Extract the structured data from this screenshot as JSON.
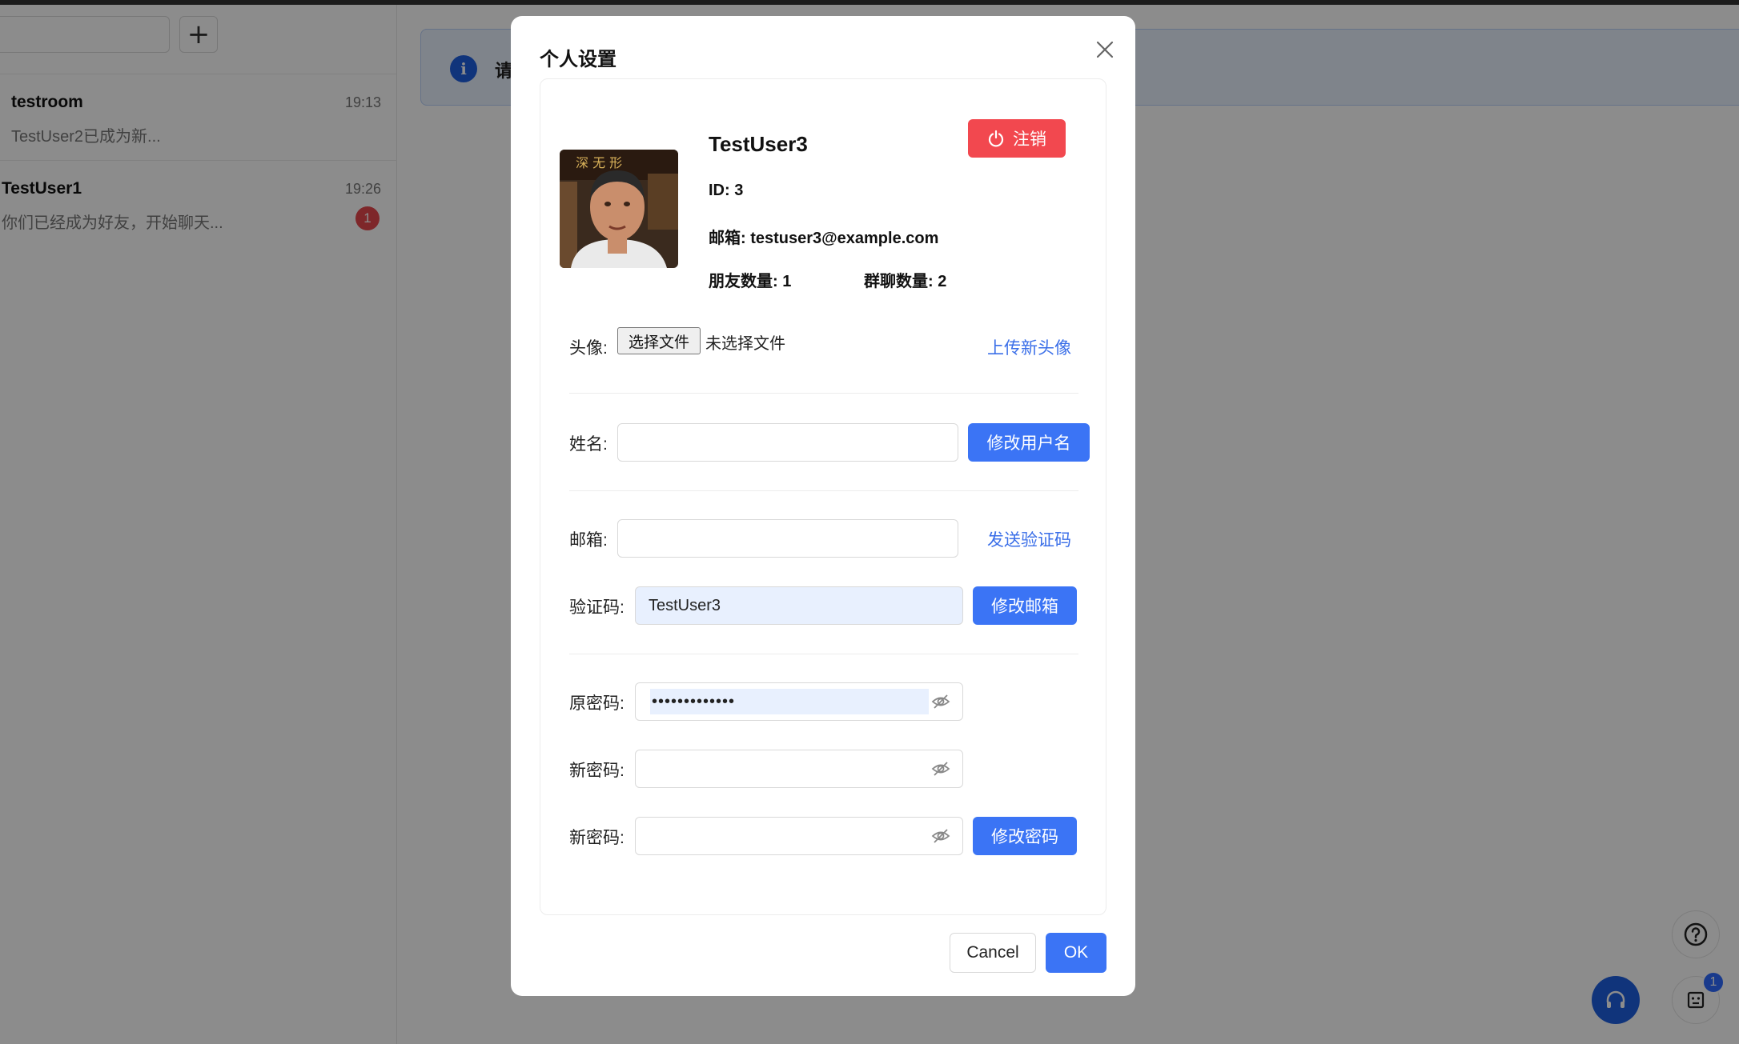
{
  "sidebar": {
    "add_icon": "plus-icon",
    "conversations": [
      {
        "name": "testroom",
        "time": "19:13",
        "preview": "TestUser2已成为新..."
      },
      {
        "name": "TestUser1",
        "time": "19:26",
        "preview": "你们已经成为好友，开始聊天...",
        "unread": "1"
      }
    ]
  },
  "main": {
    "notice_text": "请",
    "info_icon": "info-icon",
    "help_icon": "question-icon",
    "headset_icon": "headset-icon",
    "bot_icon": "robot-icon",
    "bot_badge": "1"
  },
  "modal": {
    "title": "个人设置",
    "close_icon": "close-icon",
    "profile": {
      "username": "TestUser3",
      "logout_label": "注销",
      "logout_icon": "power-icon",
      "id_line": "ID:   3",
      "email_line": "邮箱: testuser3@example.com",
      "friends_line": "朋友数量: 1",
      "groups_line": "群聊数量: 2"
    },
    "avatar_row": {
      "label": "头像:",
      "file_button": "选择文件",
      "file_status": "未选择文件",
      "upload_link": "上传新头像"
    },
    "name_row": {
      "label": "姓名:",
      "value": "",
      "button": "修改用户名"
    },
    "email_row": {
      "label": "邮箱:",
      "value": "",
      "send_code_link": "发送验证码"
    },
    "code_row": {
      "label": "验证码:",
      "value": "TestUser3",
      "button": "修改邮箱"
    },
    "old_password_row": {
      "label": "原密码:",
      "value": "•••••••••••••"
    },
    "new_password_row": {
      "label": "新密码:"
    },
    "confirm_password_row": {
      "label": "新密码:",
      "button": "修改密码"
    },
    "footer": {
      "cancel": "Cancel",
      "ok": "OK"
    },
    "colors": {
      "primary": "#3b74f5",
      "danger": "#f2484f",
      "link": "#3b6fe8"
    }
  }
}
